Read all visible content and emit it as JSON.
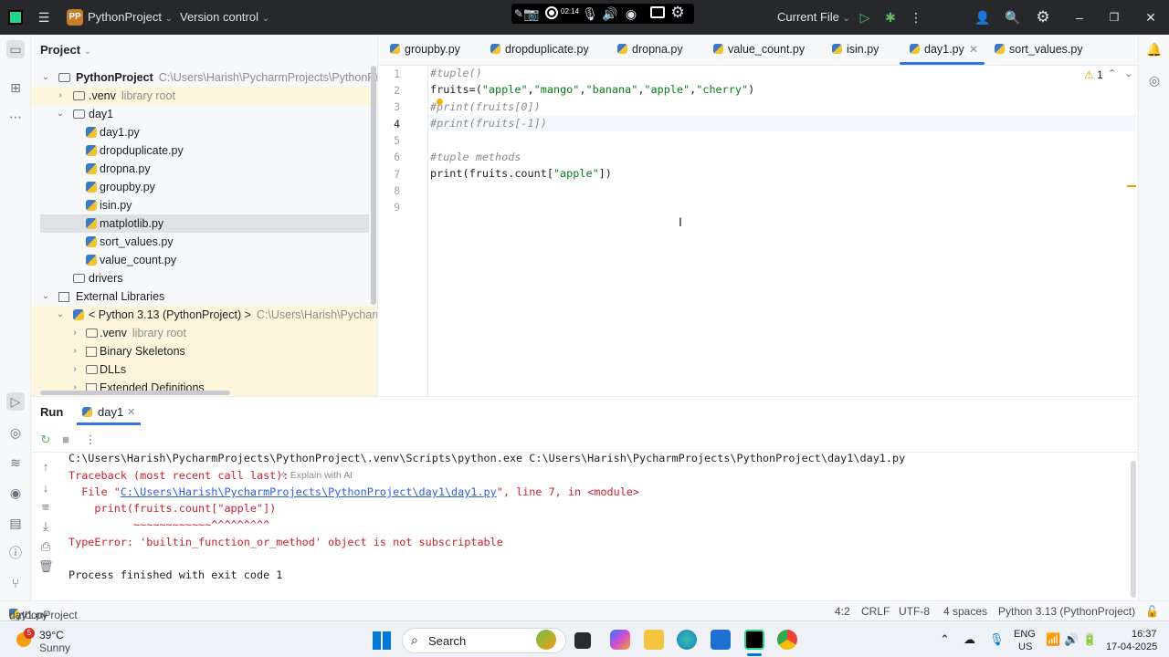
{
  "titlebar": {
    "project_badge": "PP",
    "project_name": "PythonProject",
    "version_control": "Version control",
    "rec_time": "02:14",
    "run_config": "Current File"
  },
  "project_panel": {
    "title": "Project",
    "tree": [
      {
        "label": "PythonProject",
        "hint": "C:\\Users\\Harish\\PycharmProjects\\PythonProject"
      },
      {
        "label": ".venv",
        "hint": "library root"
      },
      {
        "label": "day1",
        "hint": ""
      },
      {
        "label": "day1.py",
        "hint": ""
      },
      {
        "label": "dropduplicate.py",
        "hint": ""
      },
      {
        "label": "dropna.py",
        "hint": ""
      },
      {
        "label": "groupby.py",
        "hint": ""
      },
      {
        "label": "isin.py",
        "hint": ""
      },
      {
        "label": "matplotlib.py",
        "hint": ""
      },
      {
        "label": "sort_values.py",
        "hint": ""
      },
      {
        "label": "value_count.py",
        "hint": ""
      },
      {
        "label": "drivers",
        "hint": ""
      },
      {
        "label": "External Libraries",
        "hint": ""
      },
      {
        "label": "< Python 3.13 (PythonProject) >",
        "hint": "C:\\Users\\Harish\\PycharmPro"
      },
      {
        "label": ".venv",
        "hint": "library root"
      },
      {
        "label": "Binary Skeletons",
        "hint": ""
      },
      {
        "label": "DLLs",
        "hint": ""
      },
      {
        "label": "Extended Definitions",
        "hint": ""
      }
    ]
  },
  "editor": {
    "tabs": [
      "groupby.py",
      "dropduplicate.py",
      "dropna.py",
      "value_count.py",
      "isin.py",
      "day1.py",
      "sort_values.py"
    ],
    "active_tab": "day1.py",
    "line_numbers": [
      "1",
      "2",
      "3",
      "4",
      "5",
      "6",
      "7",
      "8",
      "9"
    ],
    "lines": [
      "#tuple()",
      "fruits=(\"apple\",\"mango\",\"banana\",\"apple\",\"cherry\")",
      "#print(fruits[0])",
      "#print(fruits[-1])",
      "",
      "#tuple methods",
      "print(fruits.count[\"apple\"])",
      "",
      ""
    ],
    "warning_count": "1"
  },
  "run_panel": {
    "title": "Run",
    "tab": "day1",
    "console": [
      "C:\\Users\\Harish\\PycharmProjects\\PythonProject\\.venv\\Scripts\\python.exe C:\\Users\\Harish\\PycharmProjects\\PythonProject\\day1\\day1.py",
      "Traceback (most recent call last):",
      "  File \"",
      "C:\\Users\\Harish\\PycharmProjects\\PythonProject\\day1\\day1.py",
      "\", line 7, in <module>",
      "    print(fruits.count[\"apple\"])",
      "          ~~~~~~~~~~~~^^^^^^^^^",
      "TypeError: 'builtin_function_or_method' object is not subscriptable",
      "",
      "Process finished with exit code 1"
    ],
    "explain_ai": "Explain with AI"
  },
  "statusbar": {
    "breadcrumb": [
      "PythonProject",
      "day1",
      "day1.py"
    ],
    "position": "4:2",
    "line_sep": "CRLF",
    "encoding": "UTF-8",
    "indent": "4 spaces",
    "interpreter": "Python 3.13 (PythonProject)"
  },
  "taskbar": {
    "weather_badge": "5",
    "temp": "39°C",
    "condition": "Sunny",
    "search": "Search",
    "lang_top": "ENG",
    "lang_bottom": "US",
    "time": "16:37",
    "date": "17-04-2025"
  }
}
